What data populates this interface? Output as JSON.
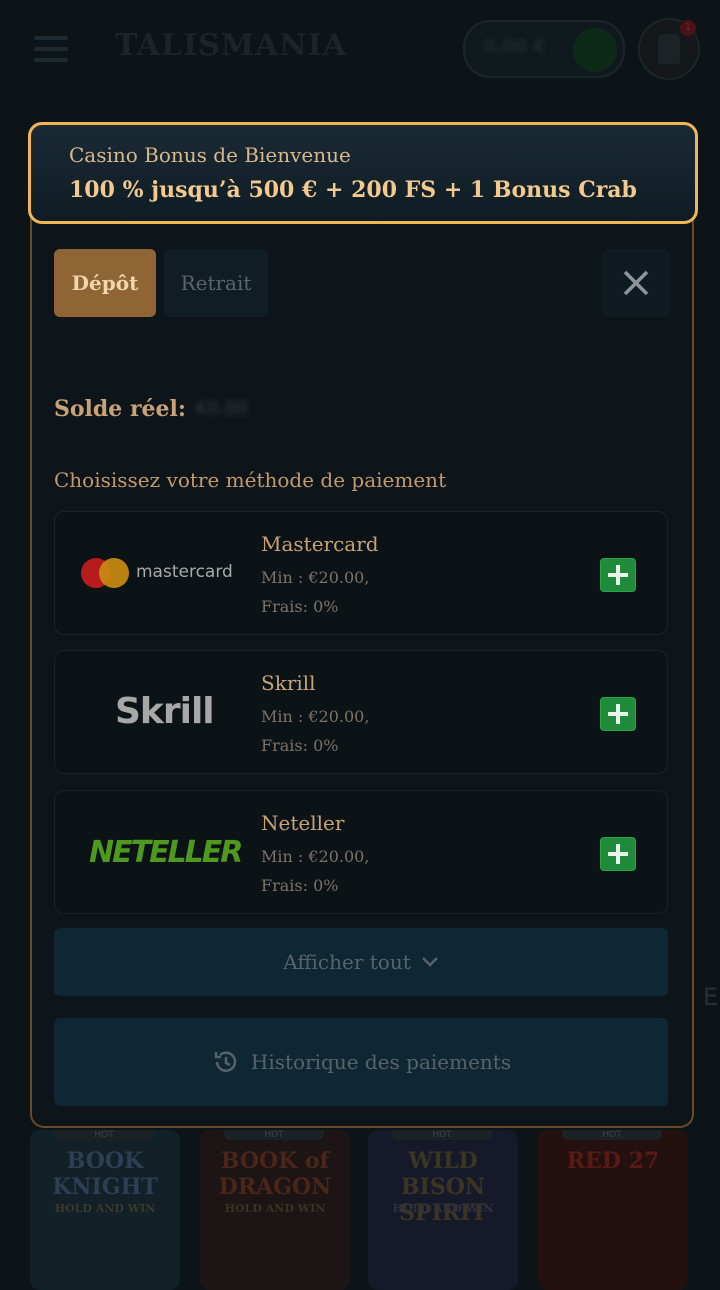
{
  "header": {
    "logo_text": "TALISMANIA",
    "balance_amount": "0,00 €",
    "notification_count": "1"
  },
  "background": {
    "side_text": "E",
    "games": [
      {
        "tag": "HOT",
        "title": "BOOK KNIGHT",
        "subtitle": "HOLD AND WIN"
      },
      {
        "tag": "HOT",
        "title": "BOOK of DRAGON",
        "subtitle": "HOLD AND WIN"
      },
      {
        "tag": "HOT",
        "title": "WILD BISON SPIRIT",
        "subtitle": "HOLD AND WIN"
      },
      {
        "tag": "HOT",
        "title": "RED 27",
        "subtitle": ""
      }
    ]
  },
  "banner": {
    "line1": "Casino Bonus de Bienvenue",
    "line2": "100 % jusqu’à 500 € + 200 FS + 1 Bonus Crab"
  },
  "tabs": {
    "deposit": "Dépôt",
    "withdraw": "Retrait"
  },
  "balance": {
    "label": "Solde réel:",
    "value": "€0.00"
  },
  "payment_prompt": "Choisissez votre méthode de paiement",
  "methods": [
    {
      "name": "Mastercard",
      "logo_text": "mastercard",
      "min": "Min : €20.00,",
      "fee": "Frais: 0%"
    },
    {
      "name": "Skrill",
      "logo_text": "Skrill",
      "min": "Min : €20.00,",
      "fee": "Frais: 0%"
    },
    {
      "name": "Neteller",
      "logo_text": "NETELLER",
      "min": "Min : €20.00,",
      "fee": "Frais: 0%"
    }
  ],
  "show_all_label": "Afficher tout",
  "history_label": "Historique des paiements",
  "colors": {
    "accent_gold": "#f2b554",
    "deposit_tab": "#8f6536",
    "add_button": "#1e8a3a"
  }
}
